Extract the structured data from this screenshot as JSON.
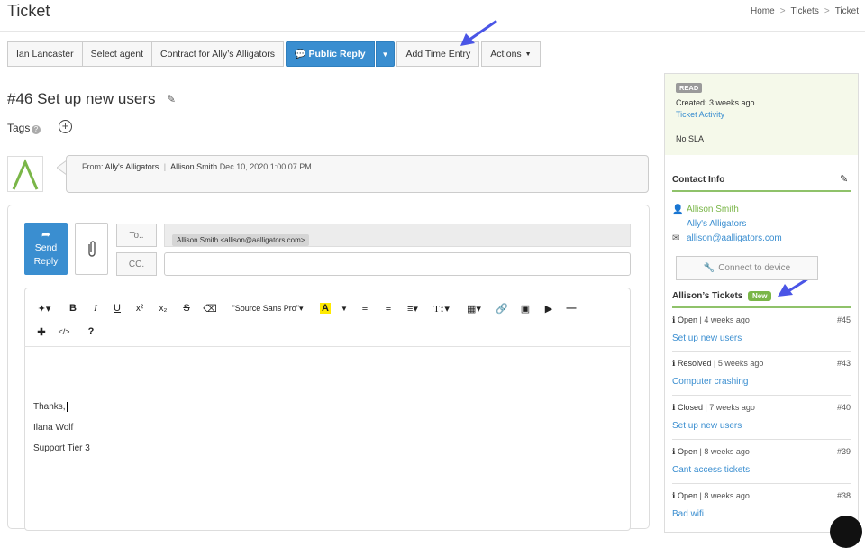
{
  "header": {
    "title": "Ticket",
    "breadcrumb": [
      "Home",
      "Tickets",
      "Ticket"
    ]
  },
  "toolbar": {
    "contact": "Ian Lancaster",
    "agent": "Select agent",
    "contract": "Contract for Ally’s Alligators",
    "public_reply": "Public Reply",
    "add_time": "Add Time Entry",
    "actions": "Actions"
  },
  "ticket": {
    "title": "#46 Set up new users",
    "tags_label": "Tags"
  },
  "message": {
    "from_label": "From:",
    "company": "Ally's Alligators",
    "sender": "Allison Smith",
    "date": "Dec 10, 2020 1:00:07 PM"
  },
  "reply": {
    "send_label_1": "Send",
    "send_label_2": "Reply",
    "to_label": "To..",
    "cc_label": "CC.",
    "to_recipient": "Allison Smith <allison@aalligators.com>",
    "font_name": "\"Source Sans Pro\"",
    "body_lines": [
      "Thanks,",
      "Ilana Wolf",
      "Support Tier 3"
    ]
  },
  "sidebar": {
    "status_badge": "READ",
    "created": "Created: 3 weeks ago",
    "activity_link": "Ticket Activity",
    "sla": "No SLA",
    "contact_title": "Contact Info",
    "contact_name": "Allison Smith",
    "contact_company": "Ally's Alligators",
    "contact_email": "allison@aalligators.com",
    "connect_label": "Connect to device",
    "tickets_title": "Allison’s Tickets",
    "new_badge": "New",
    "tickets": [
      {
        "status": "Open",
        "age": "4 weeks ago",
        "number": "#45",
        "title": "Set up new users"
      },
      {
        "status": "Resolved",
        "age": "5 weeks ago",
        "number": "#43",
        "title": "Computer crashing"
      },
      {
        "status": "Closed",
        "age": "7 weeks ago",
        "number": "#40",
        "title": "Set up new users"
      },
      {
        "status": "Open",
        "age": "8 weeks ago",
        "number": "#39",
        "title": "Cant access tickets"
      },
      {
        "status": "Open",
        "age": "8 weeks ago",
        "number": "#38",
        "title": "Bad wifi"
      }
    ]
  },
  "colors": {
    "primary": "#3a8ed0",
    "green": "#7ab648",
    "arrow": "#4a55e6"
  }
}
